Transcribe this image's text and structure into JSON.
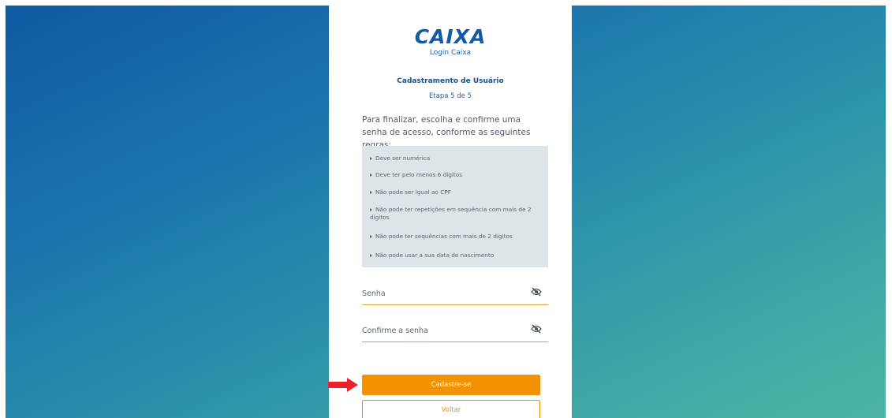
{
  "brand": {
    "logo_text": "CAIXA",
    "subtitle": "Login Caixa",
    "color": "#1459a5"
  },
  "form": {
    "heading": "Cadastramento de Usuário",
    "step": "Etapa 5 de 5",
    "intro": "Para finalizar, escolha e confirme uma senha de acesso, conforme as seguintes regras:",
    "rules": [
      "Deve ser numérica",
      "Deve ter pelo menos 6 dígitos",
      "Não pode ser igual ao CPF",
      "Não pode ter repetições em sequência com mais de 2 dígitos",
      "Não pode ter sequências com mais de 2 dígitos",
      "Não pode usar a sua data de nascimento"
    ],
    "password_placeholder": "Senha",
    "confirm_placeholder": "Confirme a senha",
    "submit_label": "Cadastre-se",
    "back_label": "Voltar"
  },
  "icons": {
    "password_toggle": "eye-slash-icon",
    "annotation": "red-arrow-icon"
  },
  "colors": {
    "accent": "#f39200",
    "rules_background": "#dde5e8",
    "background_start": "#0f5aa3",
    "background_end": "#4db4a6",
    "annotation_arrow": "#e8212a"
  }
}
